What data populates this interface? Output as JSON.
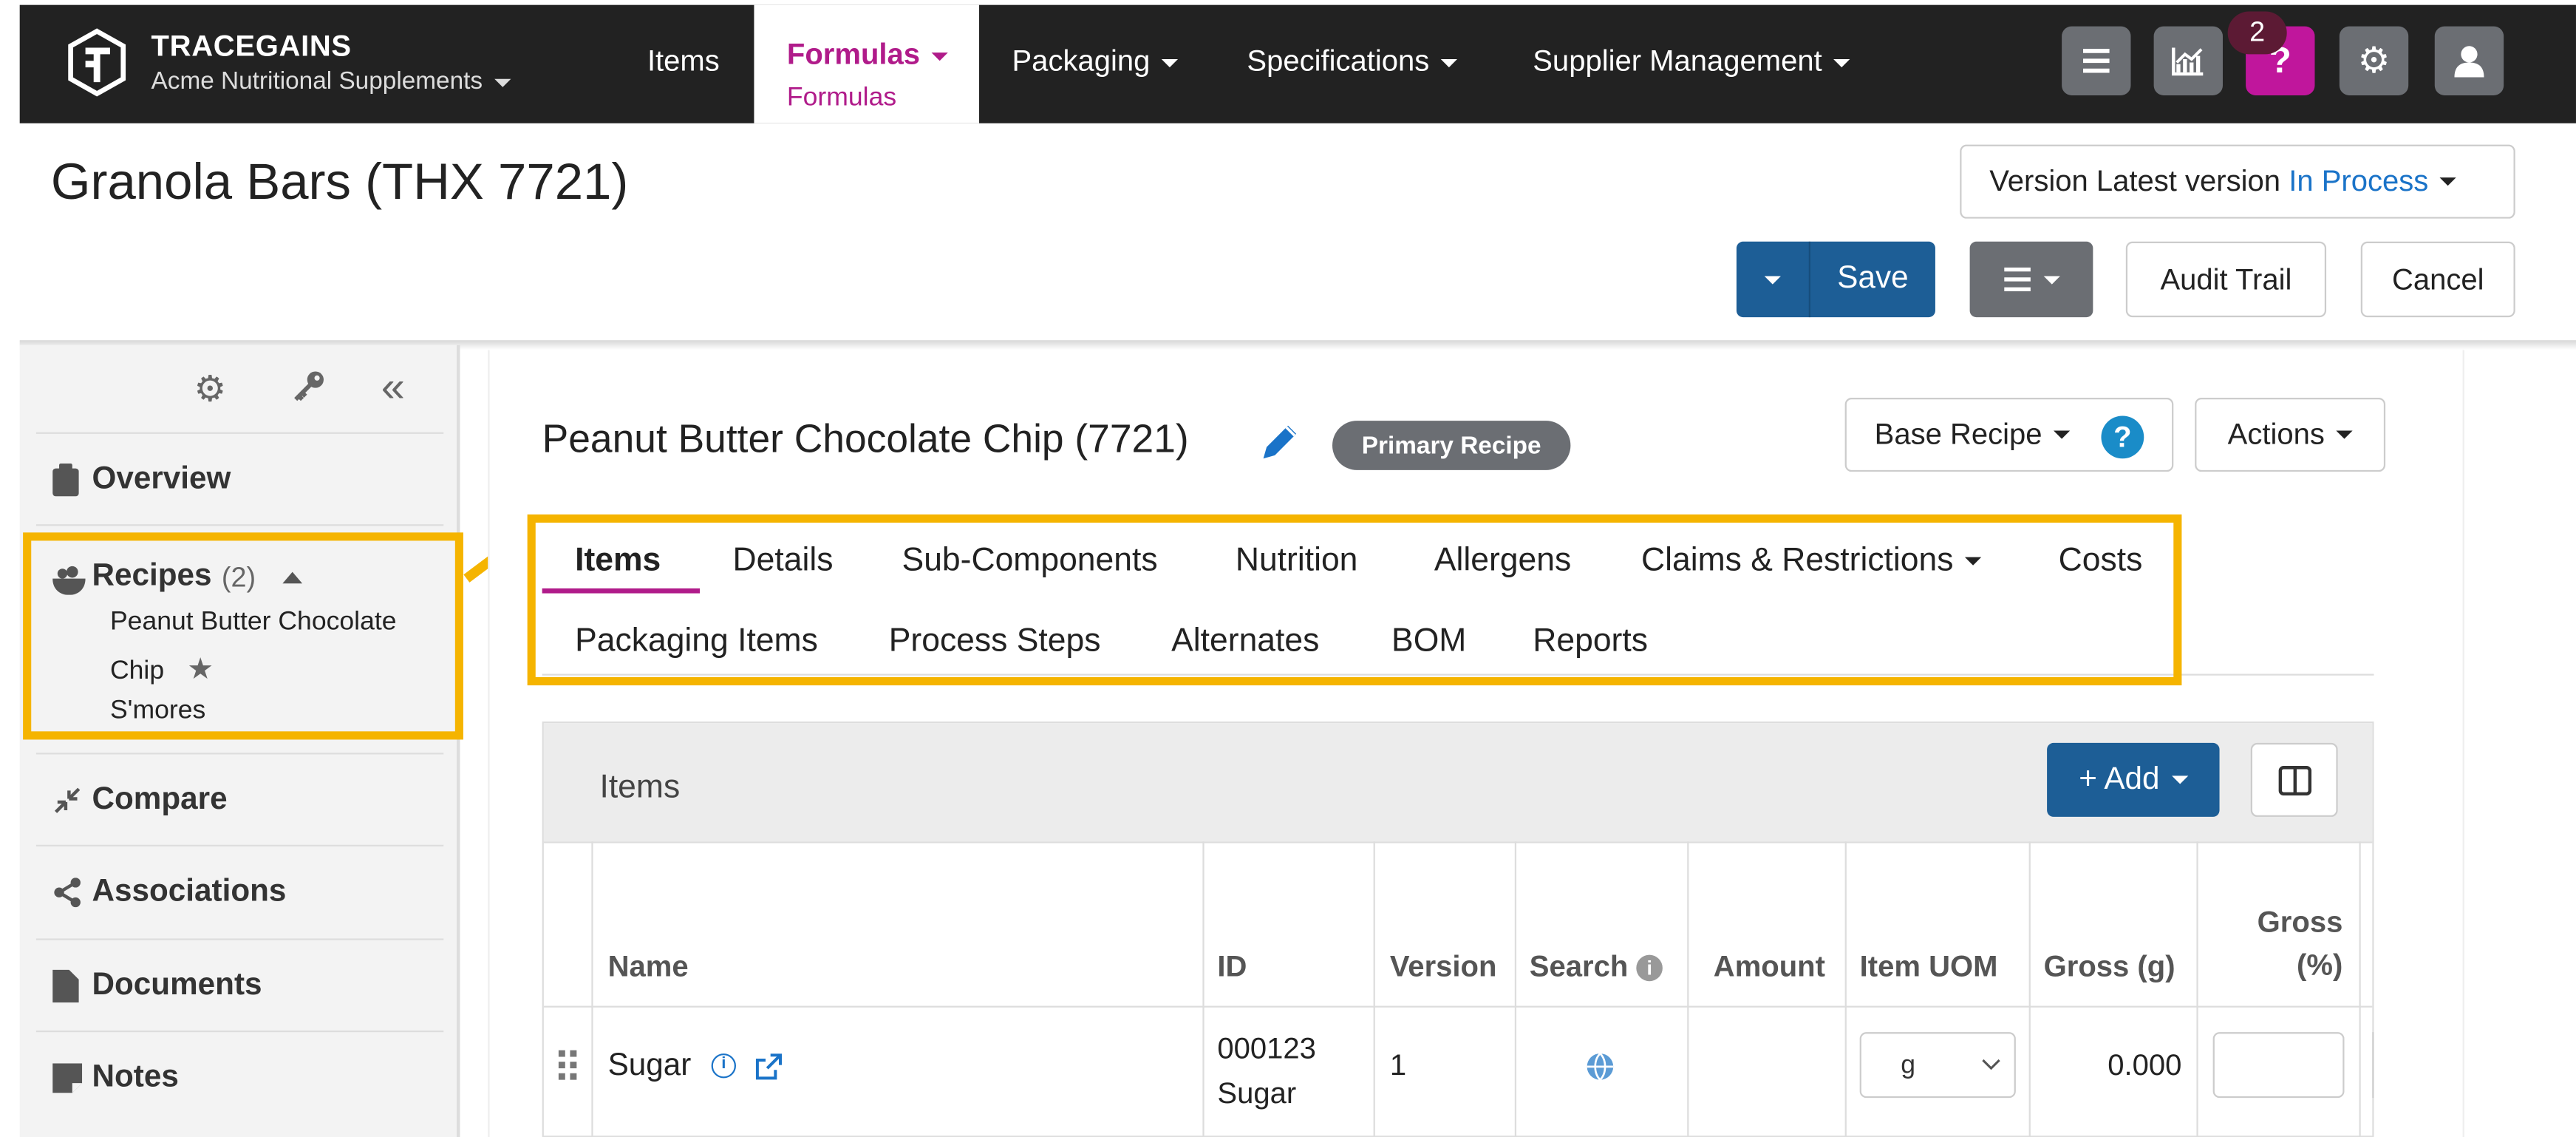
{
  "topnav": {
    "brand_name": "TRACEGAINS",
    "org_name": "Acme Nutritional Supplements",
    "items": {
      "items_label": "Items",
      "formulas_label": "Formulas",
      "formulas_sub_label": "Formulas",
      "packaging_label": "Packaging",
      "specifications_label": "Specifications",
      "supplier_label": "Supplier Management"
    },
    "help_badge_count": "2",
    "icons": [
      "menu-icon",
      "analytics-icon",
      "help-icon",
      "gear-icon",
      "user-icon"
    ],
    "accent_color": "#b01b8a"
  },
  "header": {
    "title": "Granola Bars (THX 7721)",
    "version_prefix": "Version Latest version",
    "version_status": "In Process",
    "save_label": "Save",
    "audit_trail_label": "Audit Trail",
    "cancel_label": "Cancel"
  },
  "sidebar": {
    "overview_label": "Overview",
    "recipes_label": "Recipes",
    "recipes_count": "(2)",
    "recipe_1_line1": "Peanut Butter Chocolate",
    "recipe_1_line2": "Chip",
    "recipe_2": "S'mores",
    "compare_label": "Compare",
    "associations_label": "Associations",
    "documents_label": "Documents",
    "notes_label": "Notes"
  },
  "recipe": {
    "title": "Peanut Butter Chocolate Chip (7721)",
    "badge": "Primary Recipe",
    "base_recipe_label": "Base Recipe",
    "actions_label": "Actions"
  },
  "tabs": {
    "row1": [
      "Items",
      "Details",
      "Sub-Components",
      "Nutrition",
      "Allergens",
      "Claims & Restrictions",
      "Costs"
    ],
    "row2": [
      "Packaging Items",
      "Process Steps",
      "Alternates",
      "BOM",
      "Reports"
    ],
    "active": "Items"
  },
  "items_panel": {
    "title": "Items",
    "add_label": "+ Add",
    "columns": {
      "name": "Name",
      "id": "ID",
      "version": "Version",
      "search": "Search",
      "amount": "Amount",
      "item_uom": "Item UOM",
      "gross_g": "Gross (g)",
      "gross_pct_line1": "Gross",
      "gross_pct_line2": "(%)"
    },
    "rows": [
      {
        "name": "Sugar",
        "id_line1": "000123",
        "id_line2": "Sugar",
        "version": "1",
        "amount": "",
        "uom": "g",
        "gross_g": "0.000",
        "gross_pct": ""
      }
    ]
  },
  "colors": {
    "highlight": "#f5b400",
    "primary_button": "#1d5e96",
    "link_blue": "#1a73c8",
    "nav_bg": "#222222"
  }
}
